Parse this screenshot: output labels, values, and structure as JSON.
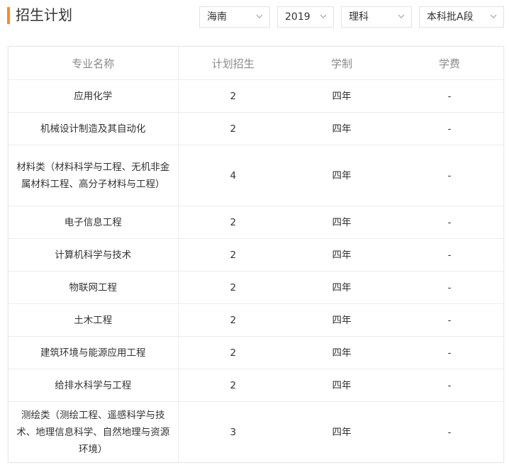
{
  "header": {
    "title": "招生计划"
  },
  "filters": {
    "province": "海南",
    "year": "2019",
    "subject": "理科",
    "batch": "本科批A段"
  },
  "table": {
    "columns": [
      "专业名称",
      "计划招生",
      "学制",
      "学费"
    ],
    "rows": [
      {
        "major": "应用化学",
        "plan": "2",
        "duration": "四年",
        "tuition": "-"
      },
      {
        "major": "机械设计制造及其自动化",
        "plan": "2",
        "duration": "四年",
        "tuition": "-"
      },
      {
        "major": "材料类（材料科学与工程、无机非金属材料工程、高分子材料与工程）",
        "plan": "4",
        "duration": "四年",
        "tuition": "-"
      },
      {
        "major": "电子信息工程",
        "plan": "2",
        "duration": "四年",
        "tuition": "-"
      },
      {
        "major": "计算机科学与技术",
        "plan": "2",
        "duration": "四年",
        "tuition": "-"
      },
      {
        "major": "物联网工程",
        "plan": "2",
        "duration": "四年",
        "tuition": "-"
      },
      {
        "major": "土木工程",
        "plan": "2",
        "duration": "四年",
        "tuition": "-"
      },
      {
        "major": "建筑环境与能源应用工程",
        "plan": "2",
        "duration": "四年",
        "tuition": "-"
      },
      {
        "major": "给排水科学与工程",
        "plan": "2",
        "duration": "四年",
        "tuition": "-"
      },
      {
        "major": "测绘类（测绘工程、遥感科学与技术、地理信息科学、自然地理与资源环境）",
        "plan": "3",
        "duration": "四年",
        "tuition": "-"
      }
    ]
  },
  "colors": {
    "accent": "#ff8a1f",
    "header_text": "#8a8a8a",
    "border": "#ececec"
  },
  "icons": {
    "dropdown": "chevron-down-icon"
  }
}
